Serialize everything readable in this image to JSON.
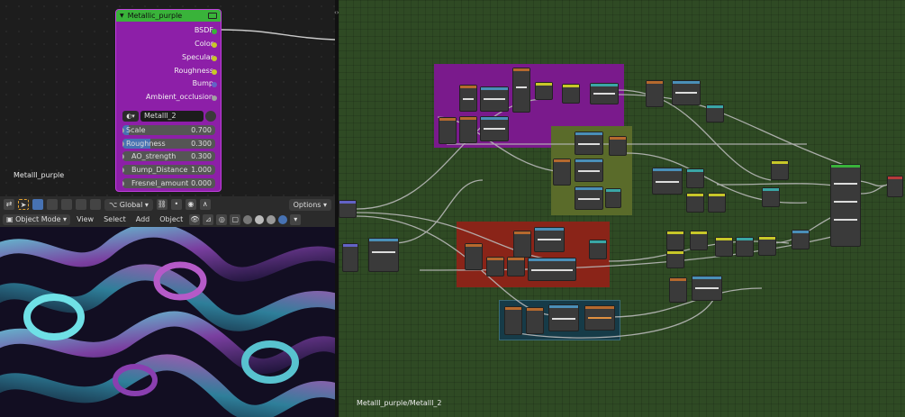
{
  "left_editor": {
    "material_label": "Metalll_purple",
    "node": {
      "title": "Metallic_purple",
      "outputs": [
        {
          "label": "BSDF",
          "color": "#39b33a"
        },
        {
          "label": "Color",
          "color": "#c7c729"
        },
        {
          "label": "Specular",
          "color": "#c7c729"
        },
        {
          "label": "Roughness",
          "color": "#c7c729"
        },
        {
          "label": "Bump",
          "color": "#6363c7"
        },
        {
          "label": "Ambient_occlusion",
          "color": "#a1a1a1"
        }
      ],
      "datablock_name": "Metalll_2",
      "inputs": [
        {
          "label": "Scale",
          "value": "0.700",
          "fraction": 0.07
        },
        {
          "label": "Roughness",
          "value": "0.300",
          "fraction": 0.3
        },
        {
          "label": "AO_strength",
          "value": "0.300",
          "fraction": 0
        },
        {
          "label": "Bump_Distance",
          "value": "1.000",
          "fraction": 0
        },
        {
          "label": "Fresnel_amount",
          "value": "0.000",
          "fraction": 0
        }
      ]
    }
  },
  "left_toolbar": {
    "orientation": "Global",
    "options": "Options"
  },
  "viewport_header": {
    "mode": "Object Mode",
    "menu": [
      "View",
      "Select",
      "Add",
      "Object"
    ]
  },
  "right_editor": {
    "path": "Metalll_purple/Metalll_2"
  },
  "colors": {
    "frame_purple": "#7a1a8c",
    "frame_olive": "#5a6b2a",
    "frame_red": "#8a2418",
    "frame_teal": "#163b48",
    "node_editor_bg": "#2f4a24"
  }
}
